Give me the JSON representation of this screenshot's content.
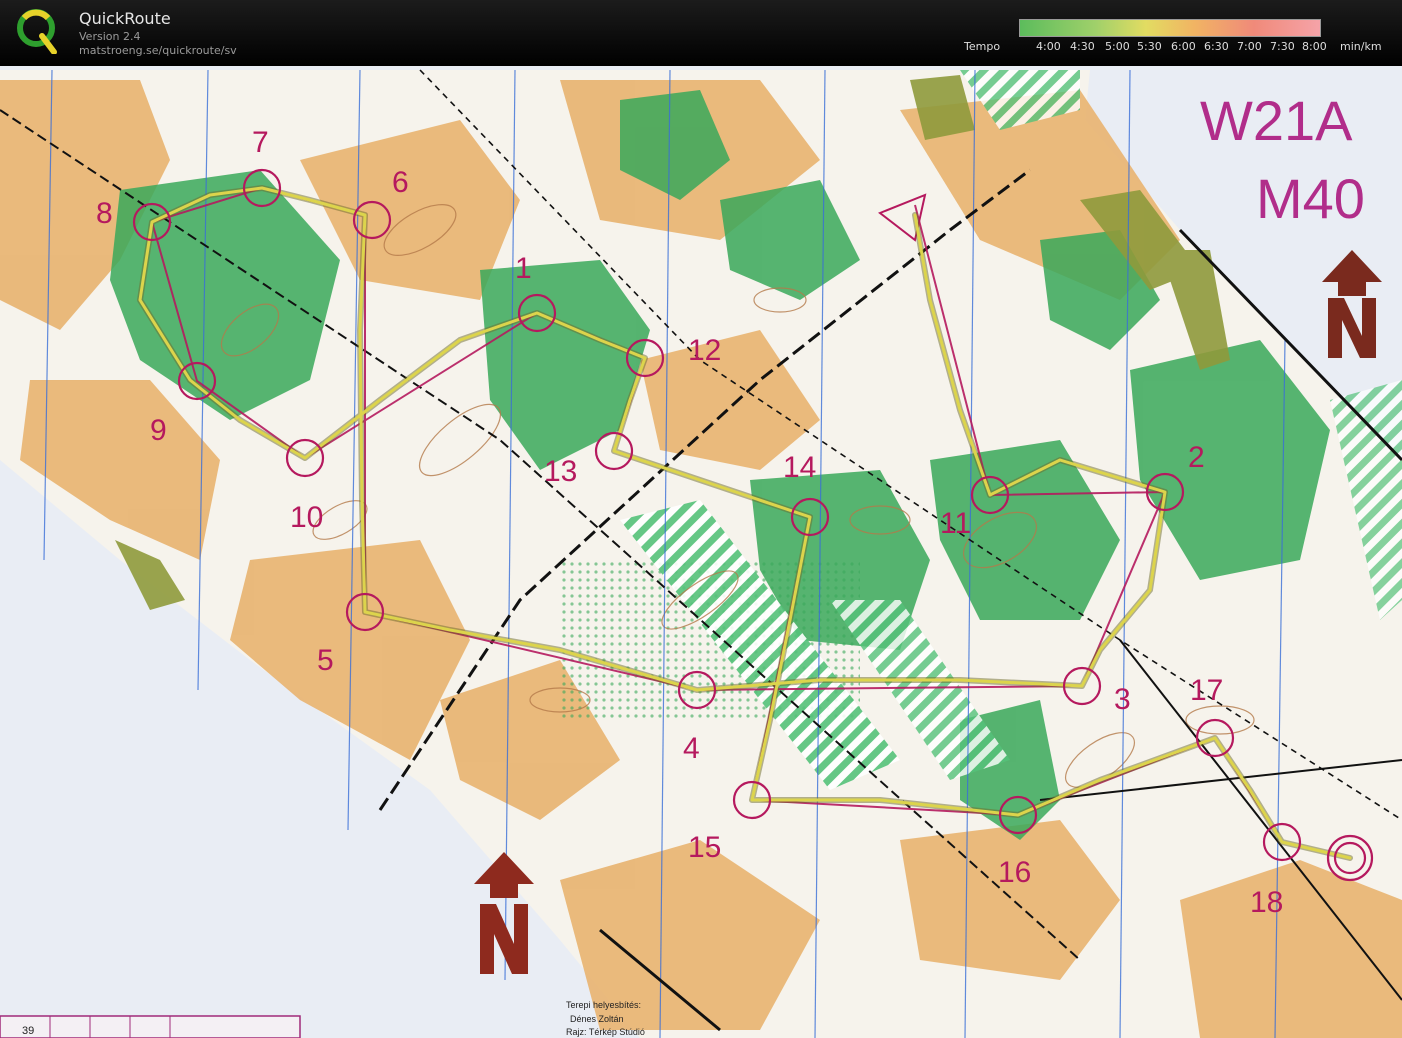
{
  "app": {
    "title": "QuickRoute",
    "version": "Version 2.4",
    "url": "matstroeng.se/quickroute/sv",
    "logo_letter": "Q"
  },
  "legend": {
    "label": "Tempo",
    "ticks": [
      "4:00",
      "4:30",
      "5:00",
      "5:30",
      "6:00",
      "6:30",
      "7:00",
      "7:30",
      "8:00"
    ],
    "unit": "min/km"
  },
  "map": {
    "course_titles": [
      "W21A",
      "M40"
    ],
    "controls": [
      {
        "label": "1"
      },
      {
        "label": "2"
      },
      {
        "label": "3"
      },
      {
        "label": "4"
      },
      {
        "label": "5"
      },
      {
        "label": "6"
      },
      {
        "label": "7"
      },
      {
        "label": "8"
      },
      {
        "label": "9"
      },
      {
        "label": "10"
      },
      {
        "label": "11"
      },
      {
        "label": "12"
      },
      {
        "label": "13"
      },
      {
        "label": "14"
      },
      {
        "label": "15"
      },
      {
        "label": "16"
      },
      {
        "label": "17"
      },
      {
        "label": "18"
      }
    ],
    "credits": [
      "Terepi helyesbítés:",
      "Dénes Zoltán",
      "Rajz: Térkép Stúdió"
    ],
    "footer_number": "39"
  },
  "colors": {
    "course": "#b5195e",
    "route": "#d8d24a",
    "forest": "#3aa85a",
    "open": "#e8b47a",
    "paper": "#eef1f6"
  }
}
